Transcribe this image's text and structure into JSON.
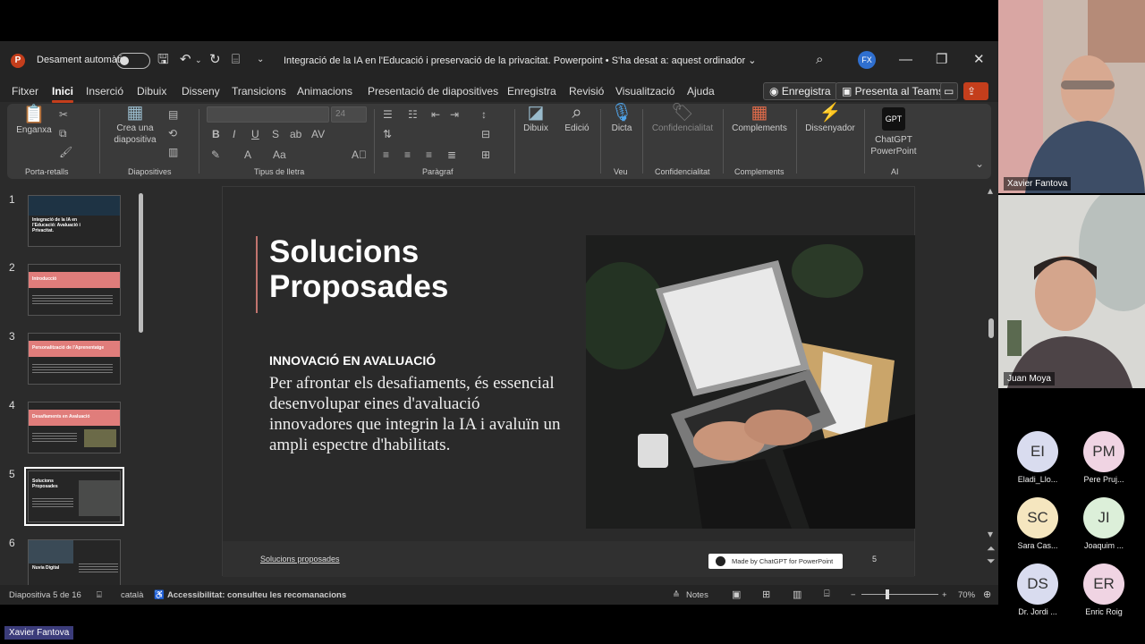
{
  "window": {
    "autosave_label": "Desament automàtic",
    "doc_title": "Integració de la IA en l'Educació i preservació de la privacitat. Powerpoint  •  S'ha desat a: aquest ordinador ⌄",
    "user_initials": "FX"
  },
  "menu": {
    "items": [
      "Fitxer",
      "Inici",
      "Inserció",
      "Dibuix",
      "Disseny",
      "Transicions",
      "Animacions",
      "Presentació de diapositives",
      "Enregistra",
      "Revisió",
      "Visualització",
      "Ajuda"
    ],
    "active": "Inici",
    "record_button": "Enregistra",
    "teams_button": "Presenta al Teams"
  },
  "ribbon": {
    "paste": "Enganxa",
    "new_slide": "Crea una\ndiapositiva",
    "draw": "Dibuix",
    "edit": "Edició",
    "dictate": "Dicta",
    "sensitivity": "Confidencialitat",
    "addins": "Complements",
    "designer": "Dissenyador",
    "chatgpt": "ChatGPT\nPowerPoint",
    "font_size": "24",
    "groups": [
      "Porta-retalls",
      "Diapositives",
      "Tipus de lletra",
      "Paràgraf",
      "Veu",
      "Confidencialitat",
      "Complements",
      "AI"
    ]
  },
  "thumbnails": [
    {
      "num": "1",
      "title": "Integració de la IA en l'Educació: Avaluació i Privacitat."
    },
    {
      "num": "2",
      "title": "Introducció"
    },
    {
      "num": "3",
      "title": "Personalització de l'Aprenentatge"
    },
    {
      "num": "4",
      "title": "Desafiaments en Avaluació"
    },
    {
      "num": "5",
      "title": "Solucions Proposades"
    },
    {
      "num": "6",
      "title": "Nuvia Digital"
    }
  ],
  "slide": {
    "title": "Solucions\nProposades",
    "subtitle": "INNOVACIÓ EN AVALUACIÓ",
    "body": "Per afrontar els desafiaments, és essencial desenvolupar eines d'avaluació innovadores que integrin la IA i avaluïn un ampli espectre d'habilitats.",
    "footer": "Solucions proposades",
    "badge": "Made by ChatGPT for PowerPoint",
    "page_number": "5"
  },
  "status": {
    "slide_count": "Diapositiva 5 de 16",
    "language": "català",
    "accessibility": "Accessibilitat: consulteu les recomanacions",
    "notes": "Notes",
    "zoom": "70%"
  },
  "participants": {
    "video": [
      {
        "name": "Xavier Fantova"
      },
      {
        "name": "Juan Moya"
      }
    ],
    "avatars": [
      {
        "initials": "EI",
        "name": "Eladi_Llo...",
        "color": "#d9dcef"
      },
      {
        "initials": "PM",
        "name": "Pere Pruj...",
        "color": "#f0d4e3"
      },
      {
        "initials": "SC",
        "name": "Sara Cas...",
        "color": "#f5e6bf"
      },
      {
        "initials": "JI",
        "name": "Joaquim ...",
        "color": "#dcefd9"
      },
      {
        "initials": "DS",
        "name": "Dr. Jordi ...",
        "color": "#d9dcef"
      },
      {
        "initials": "ER",
        "name": "Enric Roig",
        "color": "#f0d4e3"
      }
    ],
    "self_tag": "Xavier Fantova"
  }
}
